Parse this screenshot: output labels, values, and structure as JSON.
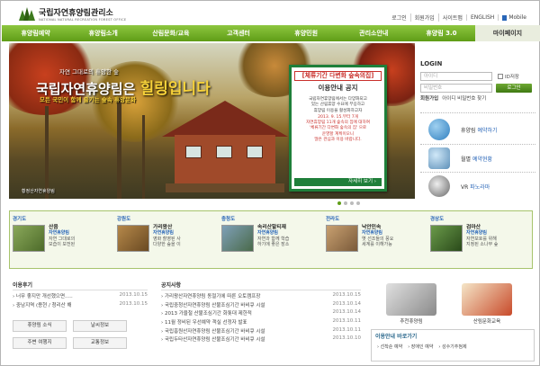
{
  "header": {
    "org_name": "국립자연휴양림관리소",
    "org_name_en": "NATIONAL NATURAL RECREATION FOREST OFFICE",
    "util_links": [
      "로그인",
      "회원가입",
      "사이트맵",
      "ENGLISH"
    ],
    "mobile_label": "Mobile"
  },
  "nav": {
    "items": [
      "휴양림예약",
      "휴양림소개",
      "산림문화/교육",
      "고객센터",
      "휴양민원",
      "관리소안내",
      "휴양림 3.0",
      "마이페이지"
    ]
  },
  "hero": {
    "top_text": "자연 그대로의 휴양한 숲",
    "title_main": "국립자연휴양림은",
    "title_accent": "힐링입니다",
    "subtitle": "모든 국민이 함께 즐기는 숲속 휴양문화",
    "caption": "황정산자연휴양림",
    "notice": {
      "header1": "[체류기간 다변화 숲속의집]",
      "header2": "이용안내 공지",
      "body1": "국립자연휴양림에서는 다양화되고\n있는 산림휴양 수요에 부응하고\n휴양림 이용을 활성화하고자",
      "body2": "2013. 9. 15.부터 7개\n자연휴양림 11개 숲속의 집에 대하여\n'체류기간 다변화 숲속의 집' 으로\n운영할 계획이오니\n많은 관심과 이용 바랍니다.",
      "more": "자세히 보기 ›"
    }
  },
  "login": {
    "title": "LOGIN",
    "id_placeholder": "아이디",
    "pw_placeholder": "비밀번호",
    "save_id": "ID저장",
    "login_btn": "로그인",
    "join": "회원가입",
    "find": "아이디 비밀번호 찾기"
  },
  "quick": [
    {
      "label": "휴양림",
      "accent": "예약하기"
    },
    {
      "label": "월별",
      "accent": "예약현황"
    },
    {
      "label": "VR",
      "accent": "파노라마"
    }
  ],
  "regions": [
    {
      "area": "경기도",
      "name": "산음",
      "type": "자연휴양림",
      "desc1": "자연 그대로의",
      "desc2": "모습이 보전된"
    },
    {
      "area": "강원도",
      "name": "가리왕산",
      "type": "자연휴양림",
      "desc1": "영화 촬영된 사",
      "desc2": "다양한 숲을 이"
    },
    {
      "area": "충청도",
      "name": "속리산말티재",
      "type": "자연휴양림",
      "desc1": "자연과 함께 학습",
      "desc2": "하기에 좋은 장소"
    },
    {
      "area": "전라도",
      "name": "낙안민속",
      "type": "자연휴양림",
      "desc1": "옛 선조들의 풍요",
      "desc2": "세계를 이해가능"
    },
    {
      "area": "경상도",
      "name": "검마산",
      "type": "자연휴양림",
      "desc1": "자연보호를 위해",
      "desc2": "지정된 소나무 숲"
    }
  ],
  "reviews": {
    "title": "이용후기",
    "items": [
      {
        "text": "너무 좋지만 개선했으면.....",
        "date": "2013.10.15"
      },
      {
        "text": "중남지역 (용현 / 청리산 해",
        "date": "2013.10.15"
      }
    ]
  },
  "bottom_buttons": [
    "휴양림 소식",
    "날씨정보",
    "주변 여행지",
    "교통정보"
  ],
  "notices": {
    "title": "공지사항",
    "items": [
      {
        "text": "가리왕산자연휴양림 동절기에 따른 오토캠프장",
        "date": "2013.10.15"
      },
      {
        "text": "국립중청산자연휴양림 산불조심기간 바비큐 시설",
        "date": "2013.10.14"
      },
      {
        "text": "2013 가을철 산불조심기간 화톳대 제한적",
        "date": "2013.10.14"
      },
      {
        "text": "11월 정비된 우선예약 객실 선정자 발표",
        "date": "2013.10.11"
      },
      {
        "text": "국립흥원산자연휴양림 산불조심기간 바비큐 시설",
        "date": "2013.10.11"
      },
      {
        "text": "국립두타산자연휴양림 산불조심기간 바비큐 시설",
        "date": "2013.10.10"
      }
    ]
  },
  "promos": {
    "recommend": "추천휴양림",
    "culture": "산림문화교육"
  },
  "guide": {
    "title": "이용안내 바로가기",
    "links": [
      "› 선착순 예약",
      "› 장애인 예약",
      "› 성수기추첨제"
    ]
  }
}
